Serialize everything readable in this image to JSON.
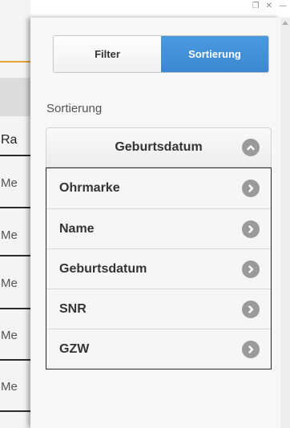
{
  "window_controls": {
    "restore_glyph": "❐",
    "close_glyph": "✕",
    "minimize_glyph": "—"
  },
  "background_table": {
    "header": "Ra",
    "rows": [
      "Me",
      "Me",
      "Me",
      "Me",
      "Me"
    ]
  },
  "panel": {
    "tabs": [
      {
        "label": "Filter",
        "active": false
      },
      {
        "label": "Sortierung",
        "active": true
      }
    ],
    "sort_label": "Sortierung",
    "select": {
      "selected": "Geburtsdatum",
      "expanded": true,
      "icon": "chevron-up-icon"
    },
    "options": [
      {
        "label": "Ohrmarke",
        "icon": "chevron-right-icon"
      },
      {
        "label": "Name",
        "icon": "chevron-right-icon"
      },
      {
        "label": "Geburtsdatum",
        "icon": "chevron-right-icon"
      },
      {
        "label": "SNR",
        "icon": "chevron-right-icon"
      },
      {
        "label": "GZW",
        "icon": "chevron-right-icon"
      }
    ]
  },
  "colors": {
    "accent_blue": "#3b88d2",
    "icon_gray": "#9a9a9a",
    "orange_line": "#e8a23a"
  }
}
